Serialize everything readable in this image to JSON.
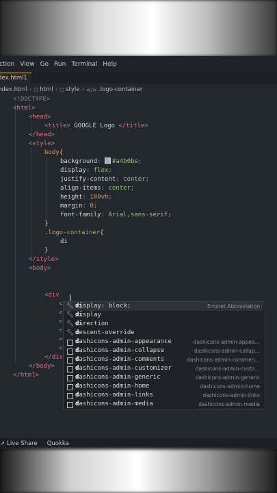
{
  "menu": [
    "ction",
    "View",
    "Go",
    "Run",
    "Terminal",
    "Help"
  ],
  "tab": {
    "label": "dex.html",
    "modified_count": "1"
  },
  "breadcrumb": {
    "file": "ndex.html",
    "html": "html",
    "style": "style",
    "class": ".logo-container"
  },
  "code": {
    "l1": "<!DOCTYPE>",
    "l2_tag": "html",
    "l3_tag": "head",
    "l4_open": "title",
    "l4_text": " GOOGLE Logo ",
    "l4_close": "/title",
    "l5_tag": "/head",
    "l6_tag": "style",
    "l7_sel": "body",
    "p_background": "background",
    "v_background": "#a4b0be",
    "p_display": "display",
    "v_display": "flex",
    "p_justify": "justify-content",
    "v_justify": "center",
    "p_align": "align-items",
    "v_align": "center",
    "p_height": "height",
    "v_height": "100vh",
    "p_margin": "margin",
    "v_margin": "0",
    "p_font": "font-family",
    "v_font": "Arial,sans-serif",
    "sel2": ".logo-container",
    "typed": "di",
    "style_close": "/style",
    "body_tag": "body",
    "div_tag": "div",
    "div_close": "/div",
    "body_close": "/body",
    "html_close": "/html"
  },
  "suggestions": [
    {
      "match": "di",
      "rest": "splay: block;",
      "detail": "Emmet Abbreviation",
      "icon": "wrench-icon"
    },
    {
      "match": "di",
      "rest": "splay",
      "detail": "",
      "icon": "wrench-icon"
    },
    {
      "match": "di",
      "rest": "rection",
      "detail": "",
      "icon": "wrench-icon"
    },
    {
      "match": "d",
      "rest": "escent-override",
      "detail": "",
      "icon": "wrench-icon"
    },
    {
      "match": "d",
      "rest": "ashicons-admin-appearance",
      "detail": "dashicons-admin-appea…",
      "icon": "text-box-icon"
    },
    {
      "match": "d",
      "rest": "ashicons-admin-collapse",
      "detail": "dashicons-admin-collap…",
      "icon": "text-box-icon"
    },
    {
      "match": "d",
      "rest": "ashicons-admin-comments",
      "detail": "dashicons-admin-commen…",
      "icon": "text-box-icon"
    },
    {
      "match": "d",
      "rest": "ashicons-admin-customizer",
      "detail": "dashicons-admin-custo…",
      "icon": "text-box-icon"
    },
    {
      "match": "d",
      "rest": "ashicons-admin-generic",
      "detail": "dashicons-admin-generic",
      "icon": "text-box-icon"
    },
    {
      "match": "d",
      "rest": "ashicons-admin-home",
      "detail": "dashicons-admin-home",
      "icon": "text-box-icon"
    },
    {
      "match": "d",
      "rest": "ashicons-admin-links",
      "detail": "dashicons-admin-links",
      "icon": "text-box-icon"
    },
    {
      "match": "d",
      "rest": "ashicons-admin-media",
      "detail": "dashicons-admin-media",
      "icon": "text-box-icon"
    }
  ],
  "status": {
    "live_share": "Live Share",
    "quokka": "Quokka"
  },
  "colors": {
    "background_swatch": "#a4b0be",
    "tab_accent": "#e8b45b"
  }
}
